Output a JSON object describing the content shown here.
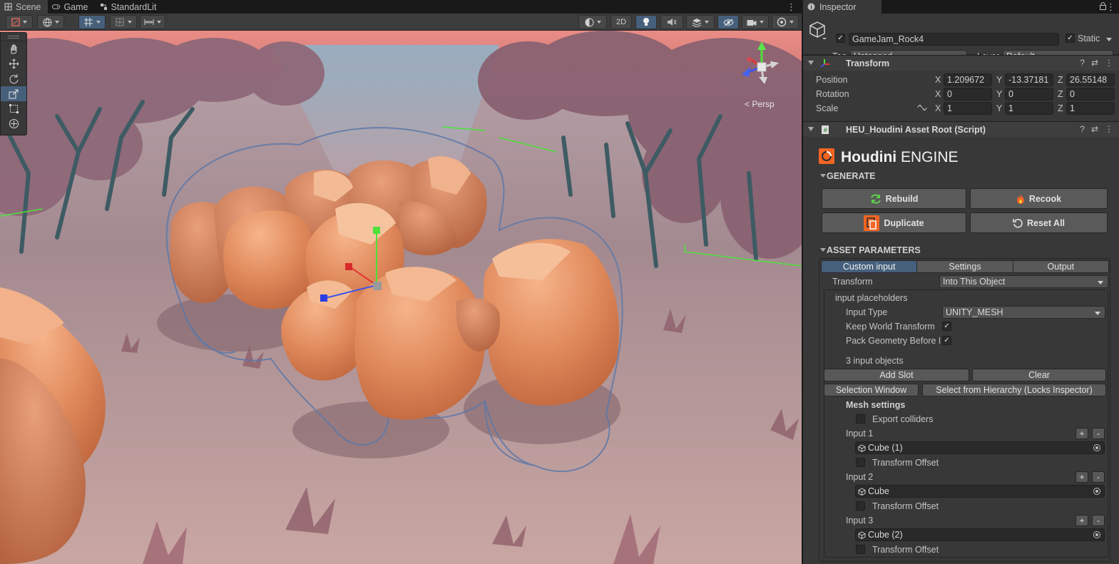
{
  "scene_tabs": [
    {
      "label": "Scene",
      "icon": "grid-icon"
    },
    {
      "label": "Game",
      "icon": "gamepad-icon"
    },
    {
      "label": "StandardLit",
      "icon": "shader-graph-icon"
    }
  ],
  "scene_toolbar": {
    "mode_2d_label": "2D",
    "persp_label": "< Persp"
  },
  "inspector": {
    "tab_label": "Inspector",
    "game_object": {
      "name": "GameJam_Rock4",
      "active": true,
      "static_label": "Static",
      "static": true,
      "tag_label": "Tag",
      "tag_value": "Untagged",
      "layer_label": "Layer",
      "layer_value": "Default"
    },
    "transform": {
      "title": "Transform",
      "position_label": "Position",
      "rotation_label": "Rotation",
      "scale_label": "Scale",
      "axis_x": "X",
      "axis_y": "Y",
      "axis_z": "Z",
      "position": {
        "x": "1.209672",
        "y": "-13.37181",
        "z": "26.55148"
      },
      "rotation": {
        "x": "0",
        "y": "0",
        "z": "0"
      },
      "scale": {
        "x": "1",
        "y": "1",
        "z": "1"
      }
    },
    "script": {
      "title": "HEU_Houdini Asset Root (Script)",
      "logo_bold": "Houdini",
      "logo_light": "ENGINE",
      "generate_label": "GENERATE",
      "rebuild_label": "Rebuild",
      "recook_label": "Recook",
      "duplicate_label": "Duplicate",
      "reset_all_label": "Reset All",
      "asset_params_label": "ASSET PARAMETERS",
      "param_tabs": [
        "Custom input",
        "Settings",
        "Output"
      ],
      "transform_label": "Transform",
      "transform_value": "Into This Object",
      "input_placeholders_label": "input placeholders",
      "input_type_label": "Input Type",
      "input_type_value": "UNITY_MESH",
      "keep_world_label": "Keep World Transform",
      "keep_world": true,
      "pack_geo_label": "Pack Geometry Before M",
      "pack_geo": true,
      "input_count_label": "3 input objects",
      "add_slot_label": "Add Slot",
      "clear_label": "Clear",
      "selection_window_label": "Selection Window",
      "select_hierarchy_label": "Select from Hierarchy (Locks Inspector)",
      "mesh_settings_label": "Mesh settings",
      "export_colliders_label": "Export colliders",
      "export_colliders": false,
      "plus_label": "+",
      "minus_label": "-",
      "inputs": [
        {
          "label": "Input 1",
          "object": "Cube (1)",
          "offset_label": "Transform Offset"
        },
        {
          "label": "Input 2",
          "object": "Cube",
          "offset_label": "Transform Offset"
        },
        {
          "label": "Input 3",
          "object": "Cube (2)",
          "offset_label": "Transform Offset"
        }
      ]
    }
  },
  "colors": {
    "accent_blue": "#46607c",
    "panel_bg": "#383838",
    "rock_orange": "#e08a5c",
    "sky_pink": "#e88a84"
  }
}
